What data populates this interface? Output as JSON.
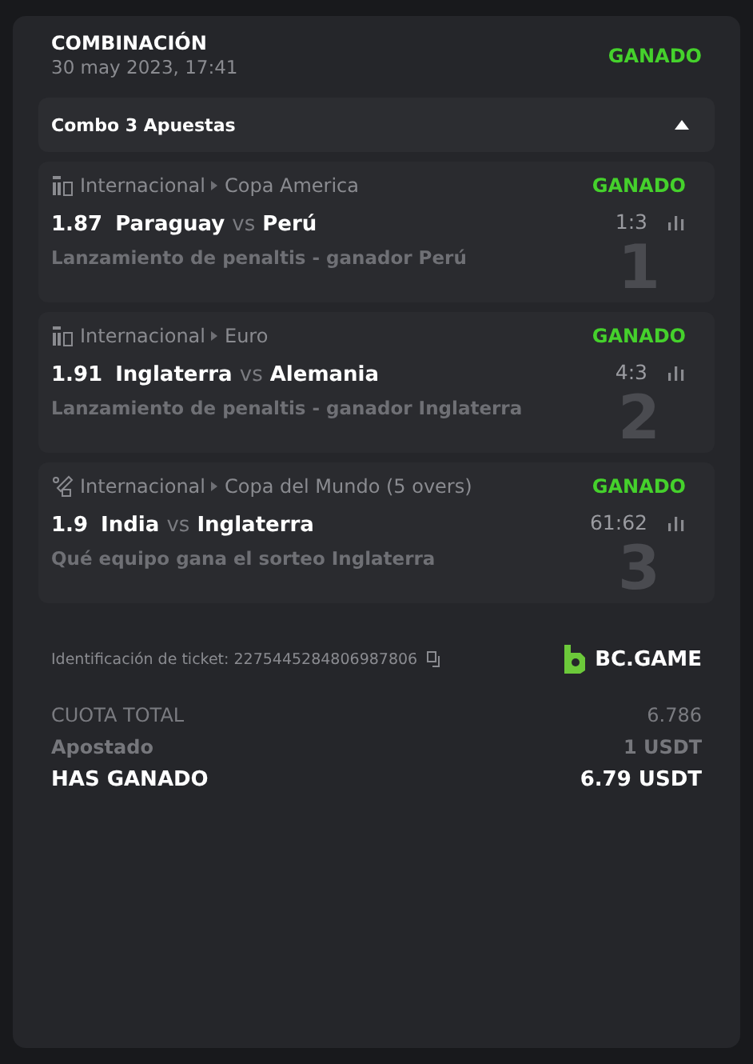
{
  "header": {
    "title": "COMBINACIÓN",
    "date": "30 may 2023, 17:41",
    "status": "GANADO"
  },
  "combo": {
    "label": "Combo 3 Apuestas",
    "expanded": true
  },
  "legs": [
    {
      "kind": "penalty",
      "region": "Internacional",
      "league": "Copa America",
      "status": "GANADO",
      "odds": "1.87",
      "home": "Paraguay",
      "vs": "vs",
      "away": "Perú",
      "score": "1:3",
      "market": "Lanzamiento de penaltis - ganador Perú",
      "index": "1"
    },
    {
      "kind": "penalty",
      "region": "Internacional",
      "league": "Euro",
      "status": "GANADO",
      "odds": "1.91",
      "home": "Inglaterra",
      "vs": "vs",
      "away": "Alemania",
      "score": "4:3",
      "market": "Lanzamiento de penaltis - ganador Inglaterra",
      "index": "2"
    },
    {
      "kind": "cricket",
      "region": "Internacional",
      "league": "Copa del Mundo (5 overs)",
      "status": "GANADO",
      "odds": "1.9",
      "home": "India",
      "vs": "vs",
      "away": "Inglaterra",
      "score": "61:62",
      "market": "Qué equipo gana el sorteo Inglaterra",
      "index": "3"
    }
  ],
  "ticket": {
    "label": "Identificación de ticket: 2275445284806987806",
    "brand": "BC.GAME"
  },
  "totals": [
    {
      "kind": "odds",
      "label": "CUOTA TOTAL",
      "value": "6.786"
    },
    {
      "kind": "stake",
      "label": "Apostado",
      "value": "1 USDT"
    },
    {
      "kind": "win",
      "label": "HAS GANADO",
      "value": "6.79 USDT"
    }
  ]
}
